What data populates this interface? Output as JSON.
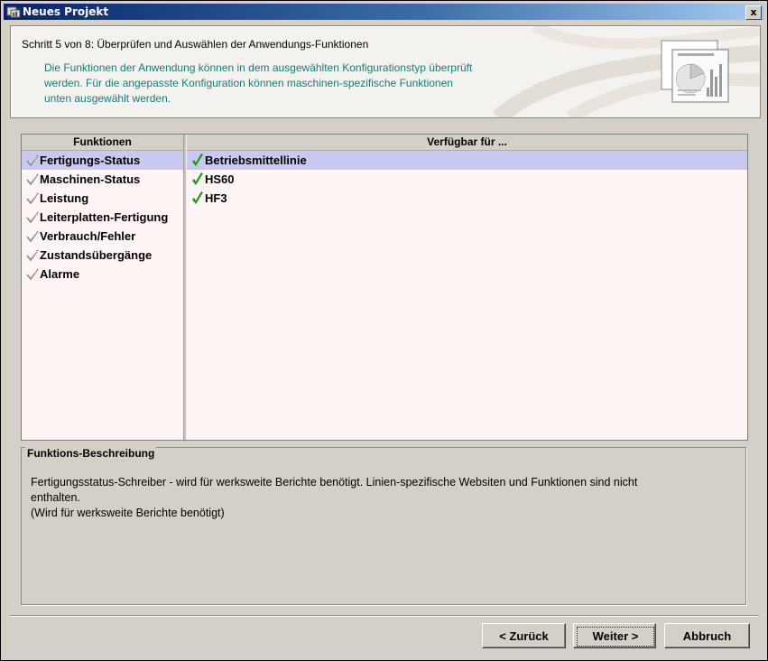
{
  "window": {
    "title": "Neues Projekt",
    "close_label": "x"
  },
  "header": {
    "step": "Schritt 5 von 8: Überprüfen und Auswählen der Anwendungs-Funktionen",
    "description_lines": [
      "Die Funktionen der Anwendung können in dem ausgewählten Konfigurationstyp überprüft",
      "werden. Für die angepasste Konfiguration können maschinen-spezifische Funktionen",
      "unten ausgewählt werden."
    ]
  },
  "functions": {
    "header": "Funktionen",
    "items": [
      {
        "label": "Fertigungs-Status",
        "selected": true
      },
      {
        "label": "Maschinen-Status",
        "selected": false
      },
      {
        "label": "Leistung",
        "selected": false
      },
      {
        "label": "Leiterplatten-Fertigung",
        "selected": false
      },
      {
        "label": "Verbrauch/Fehler",
        "selected": false
      },
      {
        "label": "Zustandsübergänge",
        "selected": false
      },
      {
        "label": "Alarme",
        "selected": false
      }
    ]
  },
  "available": {
    "header": "Verfügbar für ...",
    "items": [
      {
        "label": "Betriebsmittellinie",
        "selected": true
      },
      {
        "label": "HS60",
        "selected": false
      },
      {
        "label": "HF3",
        "selected": false
      }
    ]
  },
  "description_panel": {
    "title": "Funktions-Beschreibung",
    "lines": [
      "Fertigungsstatus-Schreiber - wird für werksweite Berichte benötigt. Linien-spezifische Websiten und Funktionen sind nicht",
      "enthalten.",
      "(Wird für werksweite Berichte benötigt)"
    ]
  },
  "buttons": {
    "back": "< Zurück",
    "next": "Weiter >",
    "cancel": "Abbruch"
  },
  "colors": {
    "selection": "#c8c8f0",
    "check_green": "#1a9a1a",
    "description_text": "#1a7a7a",
    "pane_background": "#fff5f5"
  }
}
